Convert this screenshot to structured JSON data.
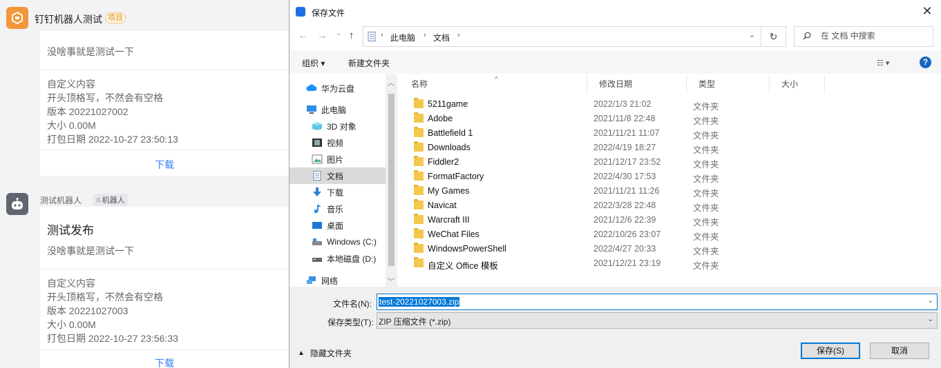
{
  "chat": {
    "group": {
      "name": "钉钉机器人测试",
      "tag": "项目"
    },
    "card1": {
      "desc": "没啥事就是测试一下",
      "custom_title": "自定义内容",
      "note": "开头顶格写，不然会有空格",
      "version": "版本 20221027002",
      "size": "大小 0.00M",
      "date": "打包日期 2022-10-27 23:50:13",
      "download": "下载"
    },
    "bot": {
      "name": "测试机器人",
      "tag": "机器人"
    },
    "card2": {
      "title": "测试发布",
      "desc": "没啥事就是测试一下",
      "custom_title": "自定义内容",
      "note": "开头顶格写，不然会有空格",
      "version": "版本 20221027003",
      "size": "大小 0.00M",
      "date": "打包日期 2022-10-27 23:56:33",
      "download": "下载"
    }
  },
  "dialog": {
    "title": "保存文件",
    "close": "✕",
    "nav": {
      "back": "←",
      "forward": "→",
      "recent": "⌄",
      "up": "↑",
      "refresh": "↻"
    },
    "breadcrumb": [
      "此电脑",
      "文档"
    ],
    "search_placeholder": "在 文档 中搜索",
    "toolbar": {
      "organize": "组织 ▾",
      "new_folder": "新建文件夹",
      "help": "?"
    },
    "nav_items": [
      {
        "label": "华为云盘",
        "icon": "cloud-icon"
      },
      {
        "label": "此电脑",
        "icon": "computer-icon"
      },
      {
        "label": "3D 对象",
        "icon": "cube-icon"
      },
      {
        "label": "视频",
        "icon": "video-icon"
      },
      {
        "label": "图片",
        "icon": "picture-icon"
      },
      {
        "label": "文档",
        "icon": "document-icon"
      },
      {
        "label": "下载",
        "icon": "download-icon"
      },
      {
        "label": "音乐",
        "icon": "music-icon"
      },
      {
        "label": "桌面",
        "icon": "desktop-icon"
      },
      {
        "label": "Windows (C:)",
        "icon": "drive-icon"
      },
      {
        "label": "本地磁盘 (D:)",
        "icon": "drive-icon"
      },
      {
        "label": "网络",
        "icon": "network-icon"
      }
    ],
    "columns": {
      "name": "名称",
      "date": "修改日期",
      "type": "类型",
      "size": "大小"
    },
    "files": [
      {
        "name": "5211game",
        "date": "2022/1/3 21:02",
        "type": "文件夹"
      },
      {
        "name": "Adobe",
        "date": "2021/11/8 22:48",
        "type": "文件夹"
      },
      {
        "name": "Battlefield 1",
        "date": "2021/11/21 11:07",
        "type": "文件夹"
      },
      {
        "name": "Downloads",
        "date": "2022/4/19 18:27",
        "type": "文件夹"
      },
      {
        "name": "Fiddler2",
        "date": "2021/12/17 23:52",
        "type": "文件夹"
      },
      {
        "name": "FormatFactory",
        "date": "2022/4/30 17:53",
        "type": "文件夹"
      },
      {
        "name": "My Games",
        "date": "2021/11/21 11:26",
        "type": "文件夹"
      },
      {
        "name": "Navicat",
        "date": "2022/3/28 22:48",
        "type": "文件夹"
      },
      {
        "name": "Warcraft III",
        "date": "2021/12/6 22:39",
        "type": "文件夹"
      },
      {
        "name": "WeChat Files",
        "date": "2022/10/26 23:07",
        "type": "文件夹"
      },
      {
        "name": "WindowsPowerShell",
        "date": "2022/4/27 20:33",
        "type": "文件夹"
      },
      {
        "name": "自定义 Office 模板",
        "date": "2021/12/21 23:19",
        "type": "文件夹"
      }
    ],
    "filename_label": "文件名(N):",
    "filename_value": "test-20221027003.zip",
    "filetype_label": "保存类型(T):",
    "filetype_value": "ZIP 压缩文件 (*.zip)",
    "hide_folders": "隐藏文件夹",
    "save": "保存(S)",
    "cancel": "取消"
  },
  "colors": {
    "accent": "#0078d7",
    "link": "#3a7ef2",
    "folder": "#f4c84c",
    "app_orange": "#f3963a"
  }
}
